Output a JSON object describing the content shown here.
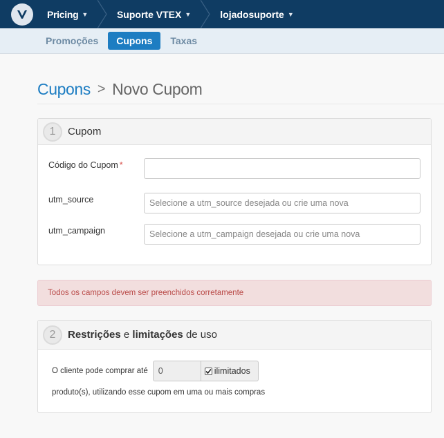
{
  "topbar": {
    "logo_icon": "vtex-logo-icon",
    "crumbs": [
      {
        "label": "Pricing"
      },
      {
        "label": "Suporte VTEX"
      },
      {
        "label": "lojadosuporte"
      }
    ],
    "background": "#0f3c63"
  },
  "tabs": [
    {
      "label": "Promoções",
      "active": false
    },
    {
      "label": "Cupons",
      "active": true
    },
    {
      "label": "Taxas",
      "active": false
    }
  ],
  "header": {
    "parent": "Cupons",
    "separator": ">",
    "current": "Novo Cupom"
  },
  "panel1": {
    "step": "1",
    "title": "Cupom",
    "fields": [
      {
        "label": "Código do Cupom",
        "required": "*",
        "value": "",
        "placeholder": ""
      },
      {
        "label": "utm_source",
        "placeholder": "Selecione a utm_source desejada ou crie uma nova"
      },
      {
        "label": "utm_campaign",
        "placeholder": "Selecione a utm_campaign desejada ou crie uma nova"
      }
    ]
  },
  "alert": {
    "text": "Todos os campos devem ser preenchidos corretamente",
    "color": "#b94a48"
  },
  "panel2": {
    "step": "2",
    "title_bold1": "Restrições",
    "title_mid": " e ",
    "title_bold2": "limitações",
    "title_end": " de uso",
    "line1_prefix": "O cliente pode comprar até",
    "quantity": "0",
    "unlimited_label": "ilimitados",
    "unlimited_checked": true,
    "line2": "produto(s), utilizando esse cupom em uma ou mais compras"
  },
  "accent": "#1d7dc2"
}
